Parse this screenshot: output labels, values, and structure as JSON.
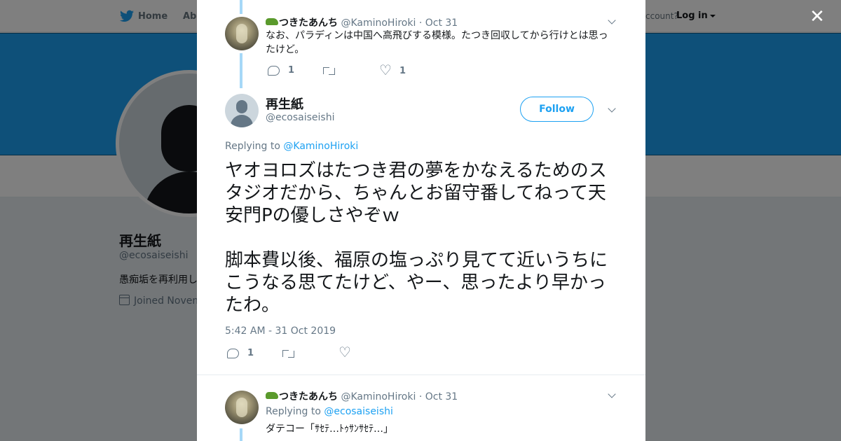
{
  "nav": {
    "home": "Home",
    "about": "Abo",
    "account_text": "ccount?",
    "login": "Log in"
  },
  "profile": {
    "name": "再生紙",
    "handle": "@ecosaiseishi",
    "bio": "愚痴垢を再利用し",
    "joined": "Joined Novem"
  },
  "thread": {
    "prev_tweet": {
      "name": "つきたあんち",
      "handle": "@KaminoHiroki",
      "dot": "·",
      "date": "Oct 31",
      "text": "なお、パラディンは中国へ高飛びする模様。たつき回収してから行けとは思ったけど。",
      "reply_count": "1",
      "retweet_count": "",
      "like_count": "1"
    },
    "focus_tweet": {
      "name": "再生紙",
      "handle": "@ecosaiseishi",
      "follow_label": "Follow",
      "replying_prefix": "Replying to",
      "replying_to": "@KaminoHiroki",
      "text": "ヤオヨロズはたつき君の夢をかなえるためのスタジオだから、ちゃんとお留守番してねって天安門Pの優しさやぞｗ\n\n脚本費以後、福原の塩っぷり見てて近いうちにこうなる思てたけど、やー、思ったより早かったわ。",
      "timestamp": "5:42 AM - 31 Oct 2019",
      "reply_count": "1",
      "retweet_count": "",
      "like_count": ""
    },
    "next_tweet": {
      "name": "つきたあんち",
      "handle": "@KaminoHiroki",
      "dot": "·",
      "date": "Oct 31",
      "replying_prefix": "Replying to",
      "replying_to": "@ecosaiseishi",
      "text": "ダテコー「ｻｾﾃ…ﾄｩｻﾝｻｾﾃ…」"
    }
  },
  "colors": {
    "accent": "#1da1f2",
    "banner": "#1da1f2",
    "thread_line": "#a6d8f7",
    "text_secondary": "#657786"
  },
  "icons": [
    "twitter-bird-icon",
    "close-icon",
    "chevron-down-icon",
    "reply-icon",
    "retweet-icon",
    "like-icon",
    "calendar-icon",
    "caret-down-icon"
  ]
}
